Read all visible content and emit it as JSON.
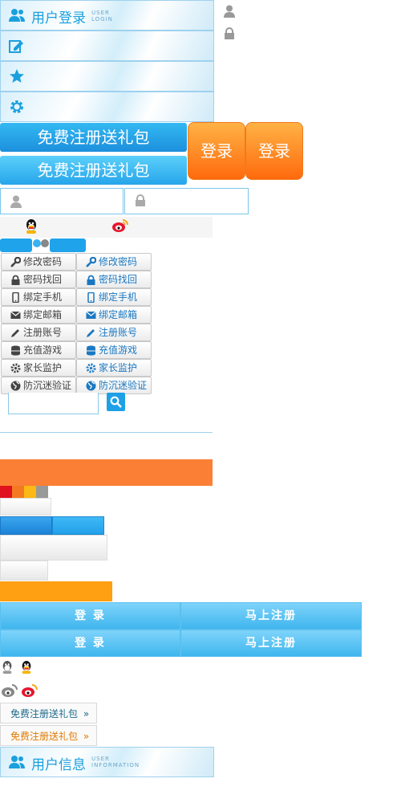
{
  "header_login": {
    "title": "用户登录",
    "en_line1": "USER",
    "en_line2": "LOGIN"
  },
  "register_gift": [
    "免费注册送礼包",
    "免费注册送礼包"
  ],
  "login_big": [
    "登录",
    "登录"
  ],
  "small_buttons": [
    {
      "label": "修改密码",
      "icon": "key-icon"
    },
    {
      "label": "密码找回",
      "icon": "lock-icon"
    },
    {
      "label": "绑定手机",
      "icon": "phone-icon"
    },
    {
      "label": "绑定邮箱",
      "icon": "mail-icon"
    },
    {
      "label": "注册账号",
      "icon": "pencil-icon"
    },
    {
      "label": "充值游戏",
      "icon": "database-icon"
    },
    {
      "label": "家长监护",
      "icon": "gear-icon"
    },
    {
      "label": "防沉迷验证",
      "icon": "globe-icon"
    }
  ],
  "login_row": {
    "login": "登 录",
    "register": "马上注册"
  },
  "gift_links": [
    "免费注册送礼包",
    "免费注册送礼包"
  ],
  "header_info": {
    "title": "用户信息",
    "en_line1": "USER",
    "en_line2": "INFORMATION"
  },
  "colors": {
    "accent_blue": "#1aa0de",
    "orange": "#ff7a1a",
    "link_blue": "#1a78c2",
    "gift_orange": "#e07a00",
    "gift_dark": "#1c6a8a"
  }
}
